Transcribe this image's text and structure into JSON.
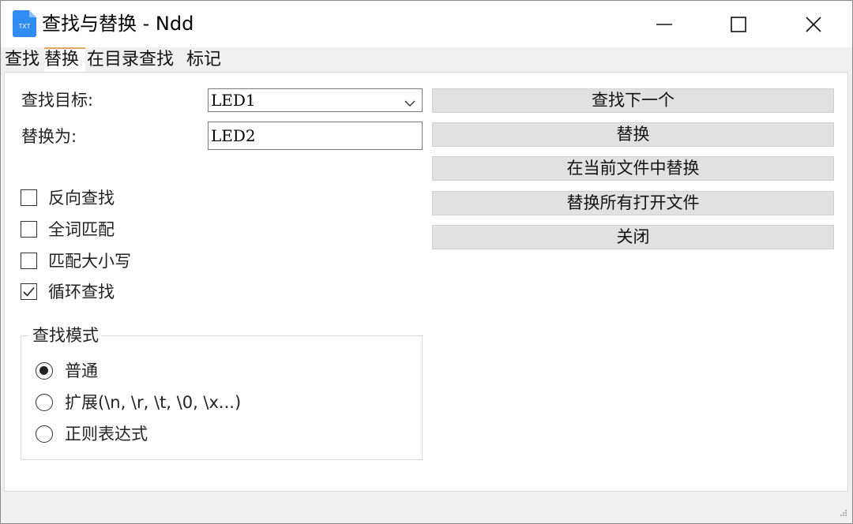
{
  "window": {
    "title": "查找与替换 - Ndd",
    "app_icon_text": "TXT"
  },
  "tabs": [
    {
      "label": "查找",
      "active": false
    },
    {
      "label": "替换",
      "active": true
    },
    {
      "label": "在目录查找",
      "active": false
    },
    {
      "label": "标记",
      "active": false
    }
  ],
  "form": {
    "find_label": "查找目标:",
    "find_value": "LED1",
    "replace_label": "替换为:",
    "replace_value": "LED2"
  },
  "buttons": {
    "find_next": "查找下一个",
    "replace": "替换",
    "replace_in_current": "在当前文件中替换",
    "replace_all_open": "替换所有打开文件",
    "close": "关闭"
  },
  "options": [
    {
      "label": "反向查找",
      "checked": false
    },
    {
      "label": "全词匹配",
      "checked": false
    },
    {
      "label": "匹配大小写",
      "checked": false
    },
    {
      "label": "循环查找",
      "checked": true
    }
  ],
  "search_mode": {
    "title": "查找模式",
    "options": [
      {
        "label": "普通",
        "selected": true
      },
      {
        "label": "扩展(\\n, \\r, \\t, \\0, \\x...)",
        "selected": false
      },
      {
        "label": "正则表达式",
        "selected": false
      }
    ]
  },
  "colors": {
    "tab_active_accent": "#e8a462",
    "app_icon_blue": "#2f8cf2",
    "button_bg": "#e1e1e1"
  }
}
